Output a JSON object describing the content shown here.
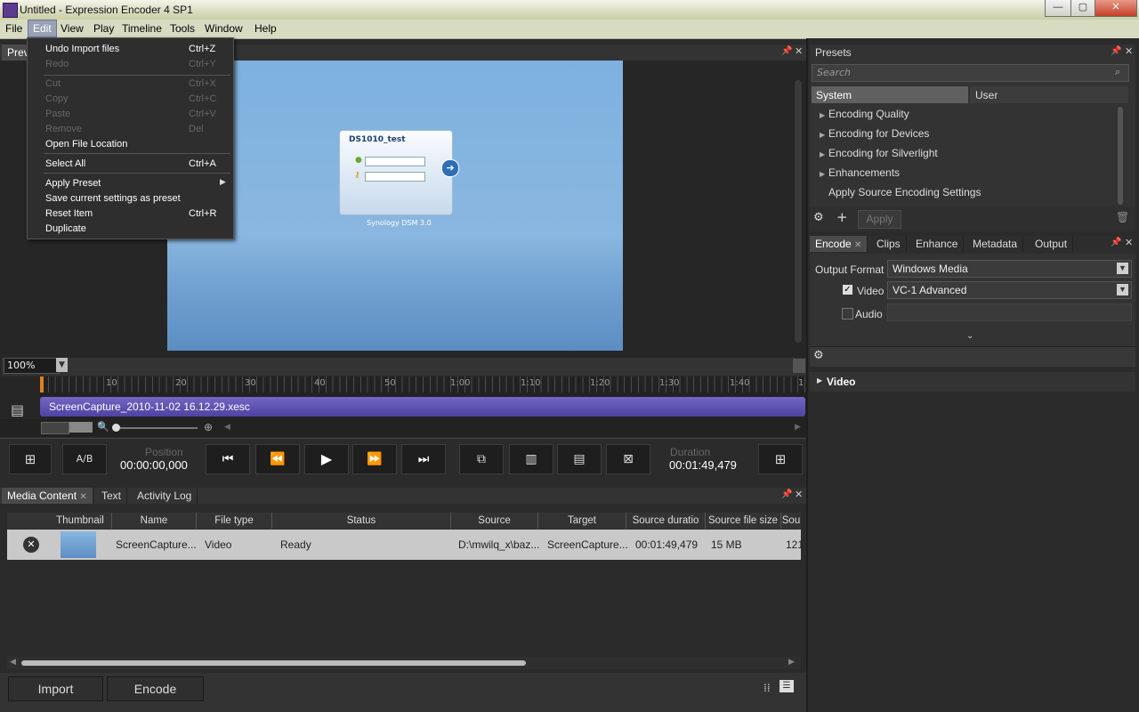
{
  "window": {
    "title": "Untitled - Expression Encoder 4 SP1",
    "minimize": "—",
    "maximize": "▢",
    "close": "✕"
  },
  "menubar": [
    "File",
    "Edit",
    "View",
    "Play",
    "Timeline",
    "Tools",
    "Window",
    "Help"
  ],
  "edit_menu": {
    "items": [
      {
        "label": "Undo Import files",
        "shortcut": "Ctrl+Z",
        "enabled": true
      },
      {
        "label": "Redo",
        "shortcut": "Ctrl+Y",
        "enabled": false
      },
      {
        "label": "Cut",
        "shortcut": "Ctrl+X",
        "enabled": false
      },
      {
        "label": "Copy",
        "shortcut": "Ctrl+C",
        "enabled": false
      },
      {
        "label": "Paste",
        "shortcut": "Ctrl+V",
        "enabled": false
      },
      {
        "label": "Remove",
        "shortcut": "Del",
        "enabled": false
      },
      {
        "label": "Open File Location",
        "shortcut": "",
        "enabled": true
      },
      {
        "label": "Select All",
        "shortcut": "Ctrl+A",
        "enabled": true
      },
      {
        "label": "Apply Preset",
        "shortcut": "",
        "enabled": true,
        "submenu": true
      },
      {
        "label": "Save current settings as preset",
        "shortcut": "",
        "enabled": true
      },
      {
        "label": "Reset Item",
        "shortcut": "Ctrl+R",
        "enabled": true
      },
      {
        "label": "Duplicate",
        "shortcut": "",
        "enabled": true
      }
    ]
  },
  "preview": {
    "tab_label": "Prev",
    "login_title": "DS1010_test",
    "brand": "Synology DSM 3.0",
    "zoom": "100%"
  },
  "timeline": {
    "ticks": [
      "10",
      "20",
      "30",
      "40",
      "50",
      "1:00",
      "1:10",
      "1:20",
      "1:30",
      "1:40",
      "1"
    ],
    "clip_name": "ScreenCapture_2010-11-02 16.12.29.xesc"
  },
  "transport": {
    "ab_label": "A/B",
    "position_label": "Position",
    "position_value": "00:00:00,000",
    "duration_label": "Duration",
    "duration_value": "00:01:49,479"
  },
  "media": {
    "tabs": [
      "Media Content",
      "Text",
      "Activity Log"
    ],
    "columns": [
      "Thumbnail",
      "Name",
      "File type",
      "Status",
      "Source",
      "Target",
      "Source duratio",
      "Source file size",
      "Sou"
    ],
    "row": {
      "name": "ScreenCapture...",
      "file_type": "Video",
      "status": "Ready",
      "source": "D:\\mwilq_x\\baz...",
      "target": "ScreenCapture...",
      "duration": "00:01:49,479",
      "size": "15 MB",
      "extra": "121"
    },
    "import_label": "Import",
    "encode_label": "Encode"
  },
  "presets": {
    "title": "Presets",
    "search_placeholder": "Search",
    "tabs": [
      "System",
      "User"
    ],
    "items": [
      {
        "label": "Encoding Quality",
        "expandable": true
      },
      {
        "label": "Encoding for Devices",
        "expandable": true
      },
      {
        "label": "Encoding for Silverlight",
        "expandable": true
      },
      {
        "label": "Enhancements",
        "expandable": true
      },
      {
        "label": "Apply Source Encoding Settings",
        "expandable": false
      }
    ],
    "apply_label": "Apply"
  },
  "encode": {
    "tabs": [
      "Encode",
      "Clips",
      "Enhance",
      "Metadata",
      "Output"
    ],
    "output_format_label": "Output Format",
    "output_format_value": "Windows Media",
    "video_label": "Video",
    "video_checked": true,
    "video_codec": "VC-1 Advanced",
    "audio_label": "Audio",
    "audio_checked": false,
    "video_section": "Video"
  },
  "colors": {
    "clip_bar": "#5a4fb0",
    "preview_bg": "#7aa8d8",
    "menubar": "#d7dbc2"
  }
}
